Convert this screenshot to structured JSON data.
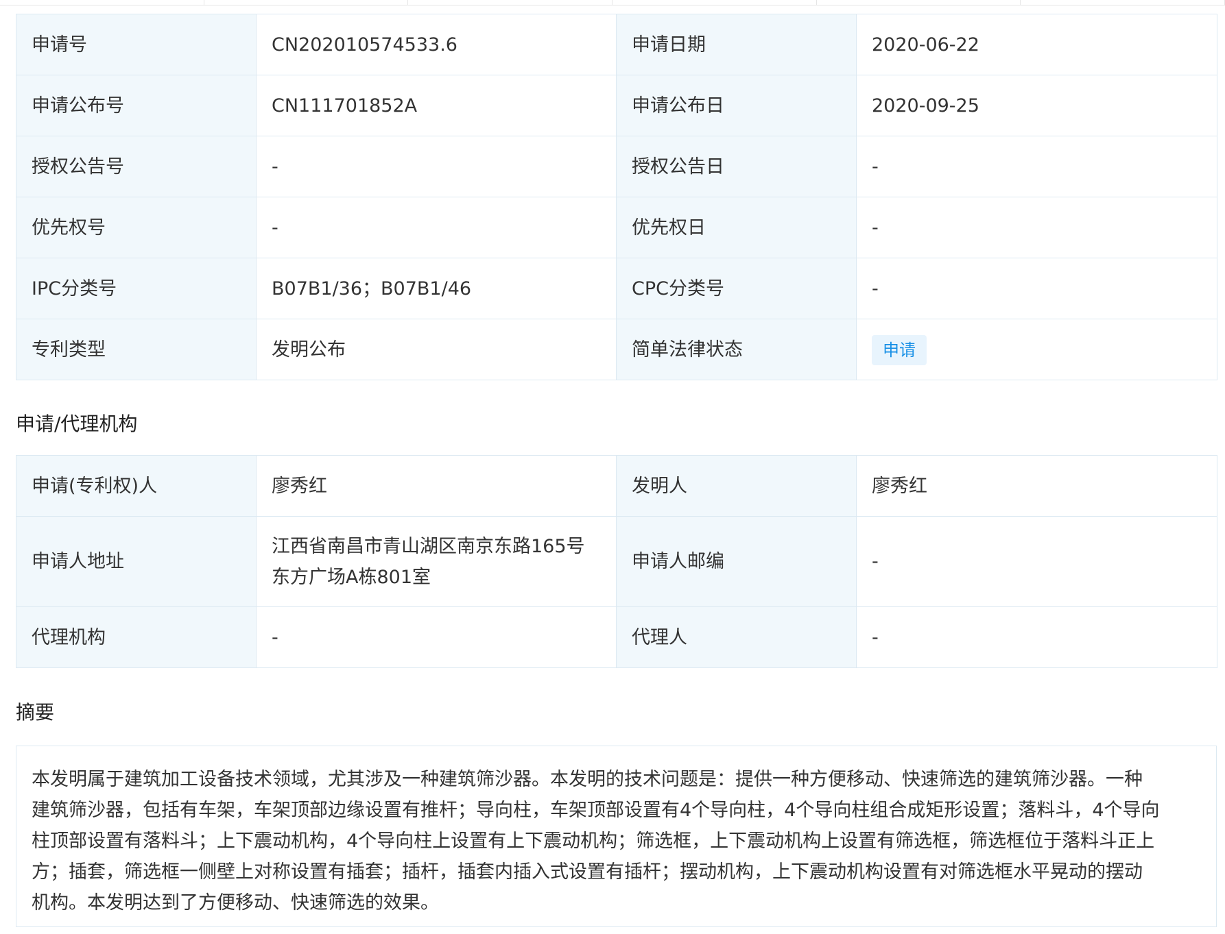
{
  "basic_info": [
    {
      "label1": "申请号",
      "value1": "CN202010574533.6",
      "label2": "申请日期",
      "value2": "2020-06-22"
    },
    {
      "label1": "申请公布号",
      "value1": "CN111701852A",
      "label2": "申请公布日",
      "value2": "2020-09-25"
    },
    {
      "label1": "授权公告号",
      "value1": "-",
      "label2": "授权公告日",
      "value2": "-"
    },
    {
      "label1": "优先权号",
      "value1": "-",
      "label2": "优先权日",
      "value2": "-"
    },
    {
      "label1": "IPC分类号",
      "value1": "B07B1/36；B07B1/46",
      "label2": "CPC分类号",
      "value2": "-"
    },
    {
      "label1": "专利类型",
      "value1": "发明公布",
      "label2": "简单法律状态",
      "value2": "申请"
    }
  ],
  "agency": {
    "title": "申请/代理机构",
    "rows": [
      {
        "label1": "申请(专利权)人",
        "value1": "廖秀红",
        "label2": "发明人",
        "value2": "廖秀红"
      },
      {
        "label1": "申请人地址",
        "value1_line1": "江西省南昌市青山湖区南京东路165号",
        "value1_line2": "东方广场A栋801室",
        "label2": "申请人邮编",
        "value2": "-"
      },
      {
        "label1": "代理机构",
        "value1": "-",
        "label2": "代理人",
        "value2": "-"
      }
    ]
  },
  "abstract": {
    "title": "摘要",
    "lines": [
      "本发明属于建筑加工设备技术领域，尤其涉及一种建筑筛沙器。本发明的技术问题是：提供一种方便移动、快速筛选的建筑筛沙器。一种",
      "建筑筛沙器，包括有车架，车架顶部边缘设置有推杆；导向柱，车架顶部设置有4个导向柱，4个导向柱组合成矩形设置；落料斗，4个导向",
      "柱顶部设置有落料斗；上下震动机构，4个导向柱上设置有上下震动机构；筛选框，上下震动机构上设置有筛选框，筛选框位于落料斗正上",
      "方；插套，筛选框一侧壁上对称设置有插套；插杆，插套内插入式设置有插杆；摆动机构，上下震动机构设置有对筛选框水平晃动的摆动",
      "机构。本发明达到了方便移动、快速筛选的效果。"
    ]
  },
  "colors": {
    "label_bg": "#f1f8fc",
    "border": "#dce9f2",
    "status_tag_bg": "#e8f4fd",
    "status_tag_text": "#1890e6"
  }
}
